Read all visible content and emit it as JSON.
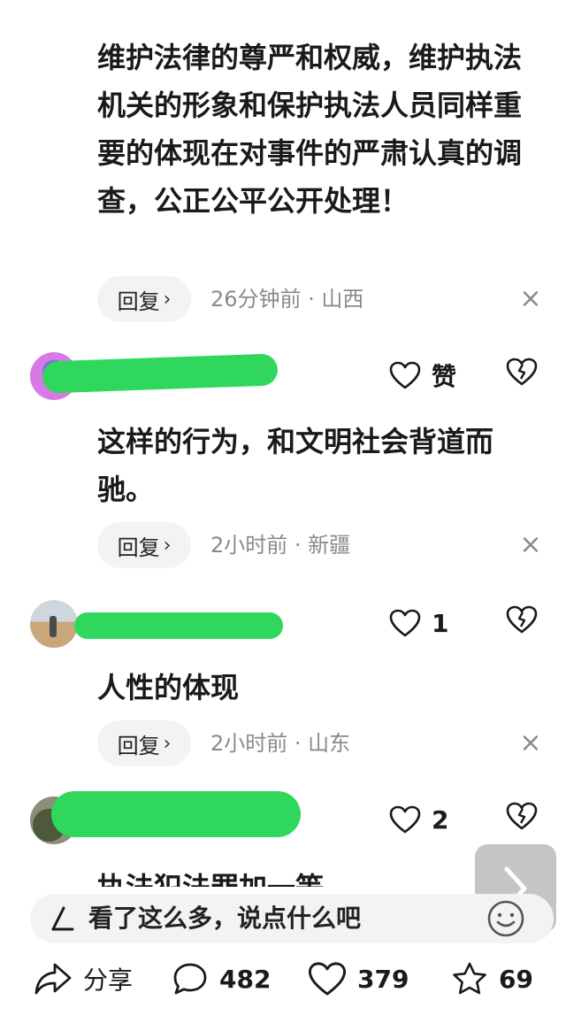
{
  "comments": [
    {
      "text": "维护法律的尊严和权威，维护执法机关的形象和保护执法人员同样重要的体现在对事件的严肃认真的调查，公正公平公开处理！",
      "reply_label": "回复",
      "meta": "26分钟前 · 山西"
    },
    {
      "username_fragment": "",
      "like_label": "赞",
      "text": "这样的行为，和文明社会背道而驰。",
      "reply_label": "回复",
      "meta": "2小时前 · 新疆"
    },
    {
      "username_fragment": "",
      "like_count": "1",
      "text": "人性的体现",
      "reply_label": "回复",
      "meta": "2小时前 · 山东"
    },
    {
      "username_fragment": "",
      "like_count": "2",
      "text_partial": "执法犯法罪加一等"
    }
  ],
  "input": {
    "placeholder": "看了这么多，说点什么吧"
  },
  "bottom_bar": {
    "share_label": "分享",
    "comment_count": "482",
    "like_count": "379",
    "favorite_count": "69"
  },
  "colors": {
    "redaction": "#2fd85d",
    "meta_gray": "#8a8a8a",
    "chip_bg": "#f2f3f5"
  },
  "icons": [
    "heart-icon",
    "broken-heart-icon",
    "close-icon",
    "share-icon",
    "comment-icon",
    "star-icon",
    "pen-icon",
    "emoji-icon",
    "chevron-right-icon"
  ]
}
